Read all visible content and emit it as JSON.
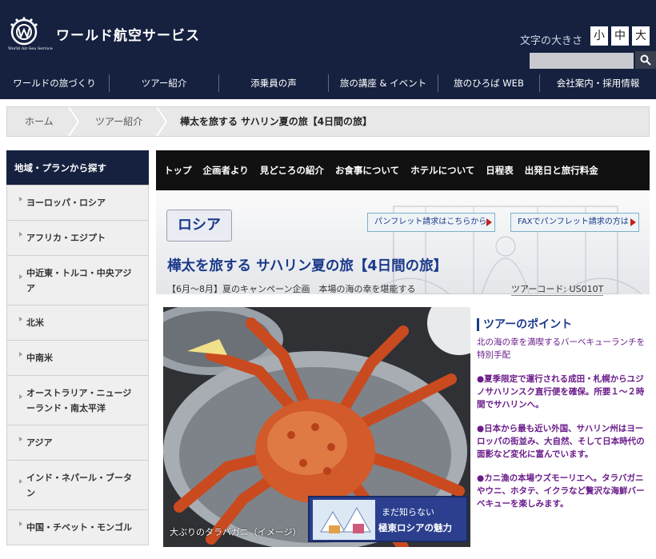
{
  "header": {
    "logo_text": "ワールド航空サービス",
    "logo_sub": "World Air-Sea Service",
    "fontsize_label": "文字の大きさ",
    "fontsize_small": "小",
    "fontsize_medium": "中",
    "fontsize_large": "大",
    "search_placeholder": ""
  },
  "gnav": [
    {
      "label": "ワールドの旅づくり"
    },
    {
      "label": "ツアー紹介"
    },
    {
      "label": "添乗員の声"
    },
    {
      "label": "旅の講座 & イベント"
    },
    {
      "label": "旅のひろば WEB"
    },
    {
      "label": "会社案内・採用情報"
    }
  ],
  "breadcrumb": {
    "home": "ホーム",
    "tours": "ツアー紹介",
    "current": "樺太を旅する サハリン夏の旅【4日間の旅】"
  },
  "sidebar": {
    "title": "地域・プランから探す",
    "items": [
      {
        "label": "ヨーロッパ・ロシア"
      },
      {
        "label": "アフリカ・エジプト"
      },
      {
        "label": "中近東・トルコ・中央アジア"
      },
      {
        "label": "北米"
      },
      {
        "label": "中南米"
      },
      {
        "label": "オーストラリア・ニュージーランド・南太平洋"
      },
      {
        "label": "アジア"
      },
      {
        "label": "インド・ネパール・ブータン"
      },
      {
        "label": "中国・チベット・モンゴル"
      }
    ]
  },
  "subnav": [
    {
      "label": "トップ"
    },
    {
      "label": "企画者より"
    },
    {
      "label": "見どころの紹介"
    },
    {
      "label": "お食事について"
    },
    {
      "label": "ホテルについて"
    },
    {
      "label": "日程表"
    },
    {
      "label": "出発日と旅行料金"
    }
  ],
  "tour": {
    "region": "ロシア",
    "pamphlet_request": "パンフレット請求はこちらから",
    "fax_request": "FAXでパンフレット請求の方は",
    "title": "樺太を旅する サハリン夏の旅【4日間の旅】",
    "subtitle": "【6月〜8月】夏のキャンペーン企画　本場の海の幸を堪能する",
    "code": "ツアーコード: US010T",
    "photo_caption": "大ぶりのタラバガニ（イメージ）",
    "badge_line1": "まだ知らない",
    "badge_line2": "極東ロシアの魅力"
  },
  "points": {
    "title": "ツアーのポイント",
    "lead": "北の海の幸を満喫するバーベキューランチを特別手配",
    "items": [
      "●夏季限定で運行される成田・札幌からユジノサハリンスク直行便を確保。所要１〜２時間でサハリンへ。",
      "●日本から最も近い外国、サハリン州はヨーロッパの街並み、大自然、そして日本時代の面影など変化に富んでいます。",
      "●カニ漁の本場ウズモーリエへ。タラバガニやウニ、ホタテ、イクラなど贅沢な海鮮バーベキューを楽しみます。"
    ]
  }
}
